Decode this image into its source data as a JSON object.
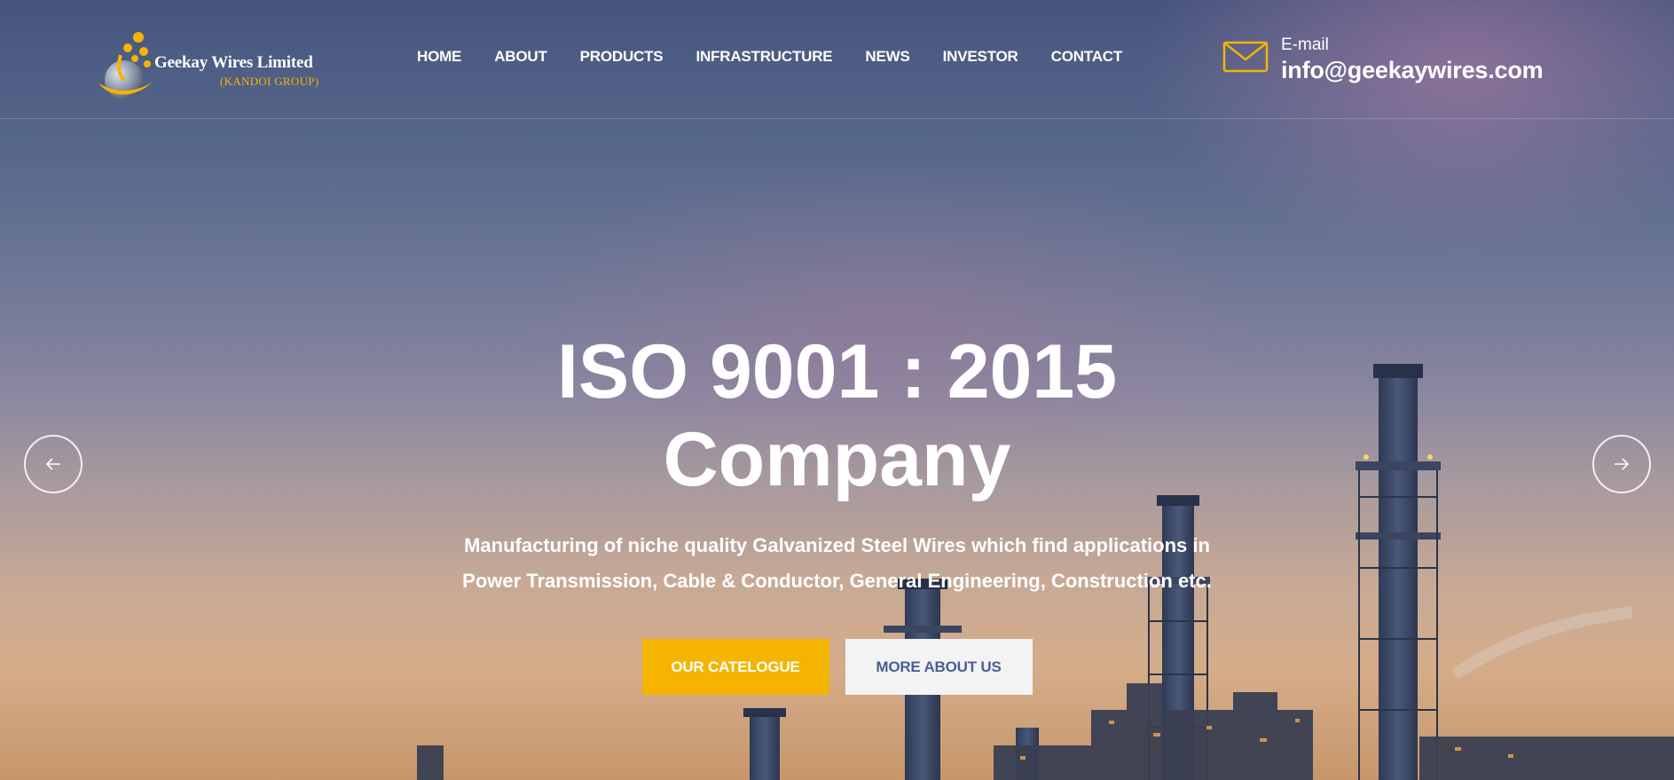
{
  "brand": {
    "name": "Geekay Wires Limited",
    "group": "(KANDOI GROUP)",
    "logo_icon": "geekay-logo-icon",
    "accent_color": "#f5b400"
  },
  "nav": {
    "items": [
      {
        "label": "HOME"
      },
      {
        "label": "ABOUT"
      },
      {
        "label": "PRODUCTS"
      },
      {
        "label": "INFRASTRUCTURE"
      },
      {
        "label": "NEWS"
      },
      {
        "label": "INVESTOR"
      },
      {
        "label": "CONTACT"
      }
    ]
  },
  "contact": {
    "icon": "envelope-icon",
    "label": "E-mail",
    "email": "info@geekaywires.com"
  },
  "hero": {
    "headline_line1": "ISO 9001 : 2015",
    "headline_line2": "Company",
    "subtitle_line1": "Manufacturing of niche quality Galvanized Steel Wires which find applications in",
    "subtitle_line2": "Power Transmission, Cable & Conductor, General Engineering, Construction etc.",
    "primary_button": "OUR CATELOGUE",
    "secondary_button": "MORE ABOUT US",
    "background": "industrial-plant-chimneys-at-dusk"
  },
  "slider": {
    "prev_icon": "arrow-left-icon",
    "next_icon": "arrow-right-icon"
  }
}
